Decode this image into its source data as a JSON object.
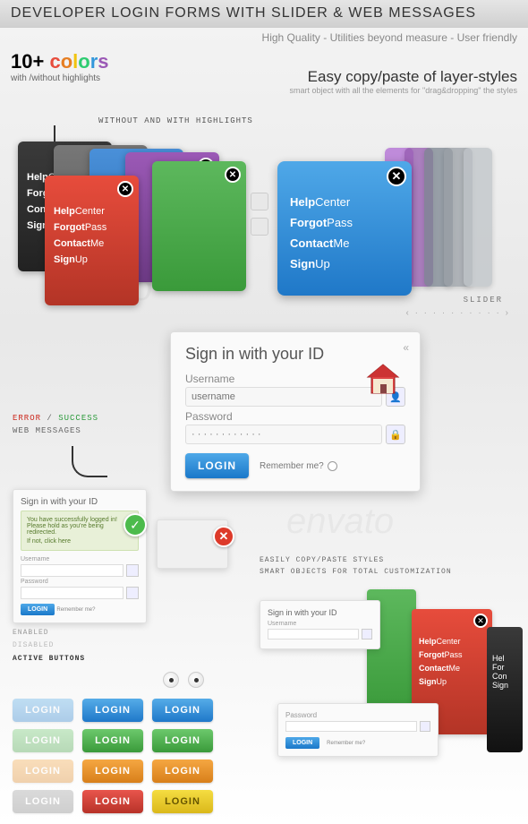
{
  "banner": "DEVELOPER LOGIN FORMS WITH SLIDER & WEB MESSAGES",
  "subtitle": "High Quality - Utilities beyond measure - User friendly",
  "colors": {
    "count": "10+",
    "word": "colors",
    "sub": "with /without highlights"
  },
  "easy": {
    "h": "Easy copy/paste of layer-styles",
    "s": "smart object with all the elements for \"drag&dropping\" the styles"
  },
  "highlight_label": "without and with highlights",
  "panel_items": [
    {
      "b": "Help",
      "r": "Center"
    },
    {
      "b": "Forgot",
      "r": "Pass"
    },
    {
      "b": "Contact",
      "r": "Me"
    },
    {
      "b": "Sign",
      "r": "Up"
    }
  ],
  "slider": {
    "label": "slider",
    "dots": "‹ · · · · · · · · · · ›"
  },
  "login": {
    "title": "Sign in with your ID",
    "username_label": "Username",
    "username_placeholder": "username",
    "password_label": "Password",
    "password_placeholder": "· · · · · · · · · · · ·",
    "button": "LOGIN",
    "remember": "Remember me?"
  },
  "messages": {
    "error": "error",
    "slash": "/",
    "success": "success",
    "sub": "web messages"
  },
  "success_msg": {
    "title": "Sign in with your ID",
    "line1": "You have successfully logged in!",
    "line2": "Please hold as you're being redirected.",
    "line3": "If not, click here"
  },
  "copy_labels": {
    "l1": "easily copy/paste styles",
    "l2": "smart objects for total customization"
  },
  "states": {
    "enabled": "enabled",
    "disabled": "disabled",
    "active": "active buttons"
  },
  "buttons": {
    "label": "LOGIN"
  },
  "thumb": {
    "title": "Sign in with your ID",
    "username": "Username",
    "password": "Password",
    "remember": "Remember me?"
  },
  "overflow": {
    "hel": "Hel",
    "for": "For",
    "con": "Con",
    "sign": "Sign"
  }
}
